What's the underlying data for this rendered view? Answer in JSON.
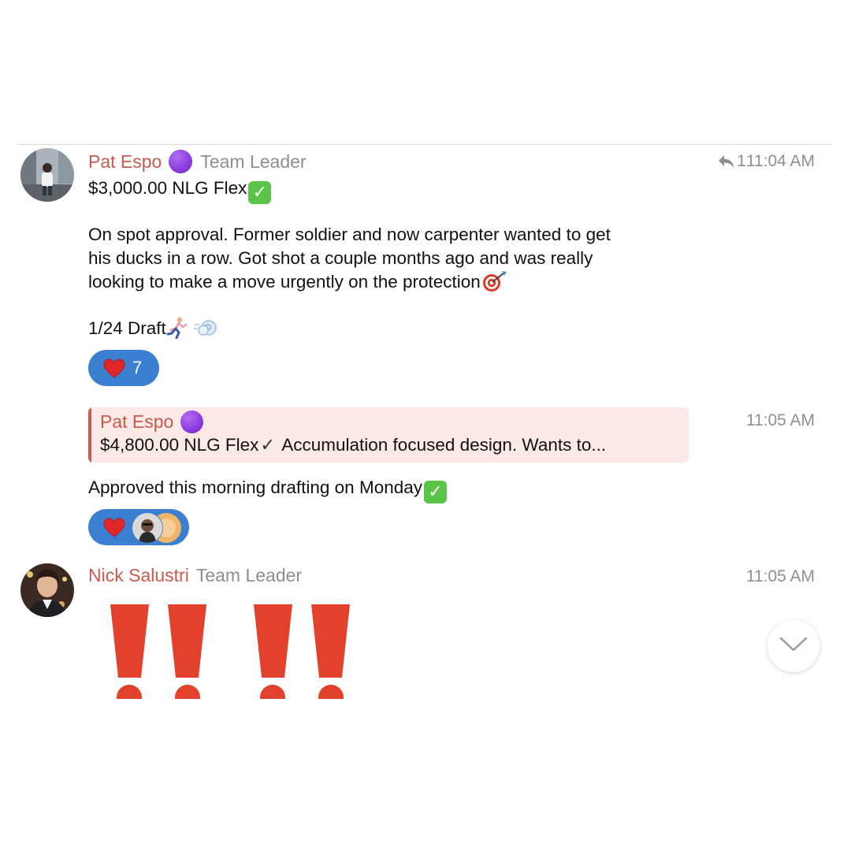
{
  "messages": [
    {
      "sender": "Pat Espo",
      "role": "Team Leader",
      "time": "11:04 AM",
      "reply_count": "1",
      "lines": {
        "title": "$3,000.00 NLG Flex",
        "body_1": "On spot approval. Former soldier and now carpenter wanted to get",
        "body_2": "his ducks in a row. Got shot a couple months ago and was really",
        "body_3": "looking to make a move urgently on the protection",
        "draft": "1/24 Draft"
      },
      "reaction": {
        "icon": "heart-icon",
        "count": "7"
      }
    },
    {
      "time": "11:05 AM",
      "quote": {
        "sender": "Pat Espo",
        "amount": "$4,800.00 NLG Flex",
        "text": "Accumulation focused design. Wants to..."
      },
      "text": "Approved this morning drafting on Monday",
      "reaction": {
        "icon": "heart-icon"
      }
    },
    {
      "sender": "Nick Salustri",
      "role": "Team Leader",
      "time": "11:05 AM"
    }
  ],
  "colors": {
    "sender": "#c85a4e",
    "reaction_pill": "#3a7fd0",
    "quote_bg": "#fbe9e8",
    "exclamation": "#e2412c"
  }
}
